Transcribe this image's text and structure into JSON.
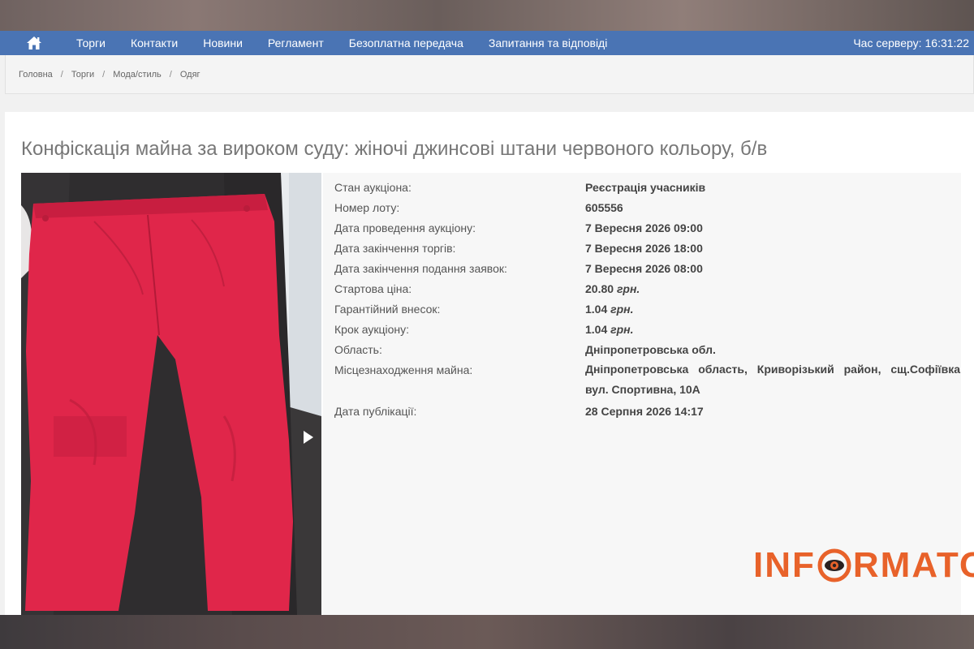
{
  "nav": {
    "home_icon": "home-icon",
    "items": [
      "Торги",
      "Контакти",
      "Новини",
      "Регламент",
      "Безоплатна передача",
      "Запитання та відповіді"
    ],
    "server_time_label": "Час серверу:",
    "server_time_value": "16:31:22"
  },
  "breadcrumb": [
    "Головна",
    "Торги",
    "Мода/стиль",
    "Одяг"
  ],
  "lot": {
    "title": "Конфіскація майна за вироком суду: жіночі джинсові штани червоного кольору, б/в",
    "fields": [
      {
        "label": "Стан аукціона:",
        "value": "Реєстрація учасників"
      },
      {
        "label": "Номер лоту:",
        "value": "605556"
      },
      {
        "label": "Дата проведення аукціону:",
        "value": "7 Вересня 2026 09:00"
      },
      {
        "label": "Дата закінчення торгів:",
        "value": "7 Вересня 2026 18:00"
      },
      {
        "label": "Дата закінчення подання заявок:",
        "value": "7 Вересня 2026 08:00"
      },
      {
        "label": "Стартова ціна:",
        "value": "20.80",
        "unit": "грн."
      },
      {
        "label": "Гарантійний внесок:",
        "value": "1.04",
        "unit": "грн."
      },
      {
        "label": "Крок аукціону:",
        "value": "1.04",
        "unit": "грн."
      },
      {
        "label": "Область:",
        "value": "Дніпропетровська обл."
      },
      {
        "label": "Місцезнаходження майна:",
        "value": "Дніпропетровська область, Криворізький район, сщ.Софіївка вул. Спортивна, 10А"
      },
      {
        "label": "Дата публікації:",
        "value": "28 Серпня 2026 14:17"
      }
    ]
  },
  "watermark": {
    "left": "INF",
    "right": "RMATOR",
    "color": "#e8622a"
  },
  "colors": {
    "navbar": "#4a74b4",
    "jeans": "#e0264a"
  }
}
